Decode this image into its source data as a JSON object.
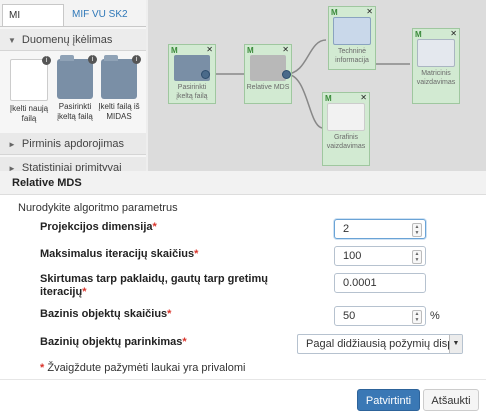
{
  "tabs": [
    "MI klasteris",
    "MIF VU SK2"
  ],
  "sidebar": {
    "section_open": "Duomenų įkėlimas",
    "files": [
      {
        "label": "Įkelti naują failą",
        "icon": "document-icon"
      },
      {
        "label": "Pasirinkti įkeltą failą",
        "icon": "folder-icon"
      },
      {
        "label": "Įkelti failą iš MIDAS",
        "icon": "folder-icon"
      }
    ],
    "section_2": "Pirminis apdorojimas",
    "section_3": "Statistiniai primityvai"
  },
  "workflow": {
    "nodes": [
      {
        "label": "Pasirinkti įkeltą failą",
        "icon": "folder-icon"
      },
      {
        "label": "Relative MDS",
        "icon": "cube-icon"
      },
      {
        "label": "Techninė informacija",
        "icon": "table-icon"
      },
      {
        "label": "Grafinis vaizdavimas",
        "icon": "line-chart-icon"
      },
      {
        "label": "Matricinis vaizdavimas",
        "icon": "matrix-icon"
      }
    ]
  },
  "modal": {
    "title": "Relative MDS",
    "subtitle": "Nurodykite algoritmo parametrus",
    "fields": [
      {
        "label": "Projekcijos dimensija",
        "value": "2"
      },
      {
        "label": "Maksimalus iteracijų skaičius",
        "value": "100"
      },
      {
        "label": "Skirtumas tarp paklaidų, gautų tarp gretimų iteracijų",
        "value": "0.0001"
      },
      {
        "label": "Bazinis objektų skaičius",
        "value": "50",
        "unit": "%"
      },
      {
        "label": "Bazinių objektų parinkimas",
        "value": "Pagal didžiausią požymių disp"
      }
    ],
    "required_mark": "*",
    "note": "Žvaigždute pažymėti laukai yra privalomi",
    "confirm_button": "Patvirtinti",
    "cancel_button": "Atšaukti"
  },
  "colors": {
    "accent": "#3a78b5",
    "required": "#d9342b",
    "node_bg": "#d2ead2"
  }
}
